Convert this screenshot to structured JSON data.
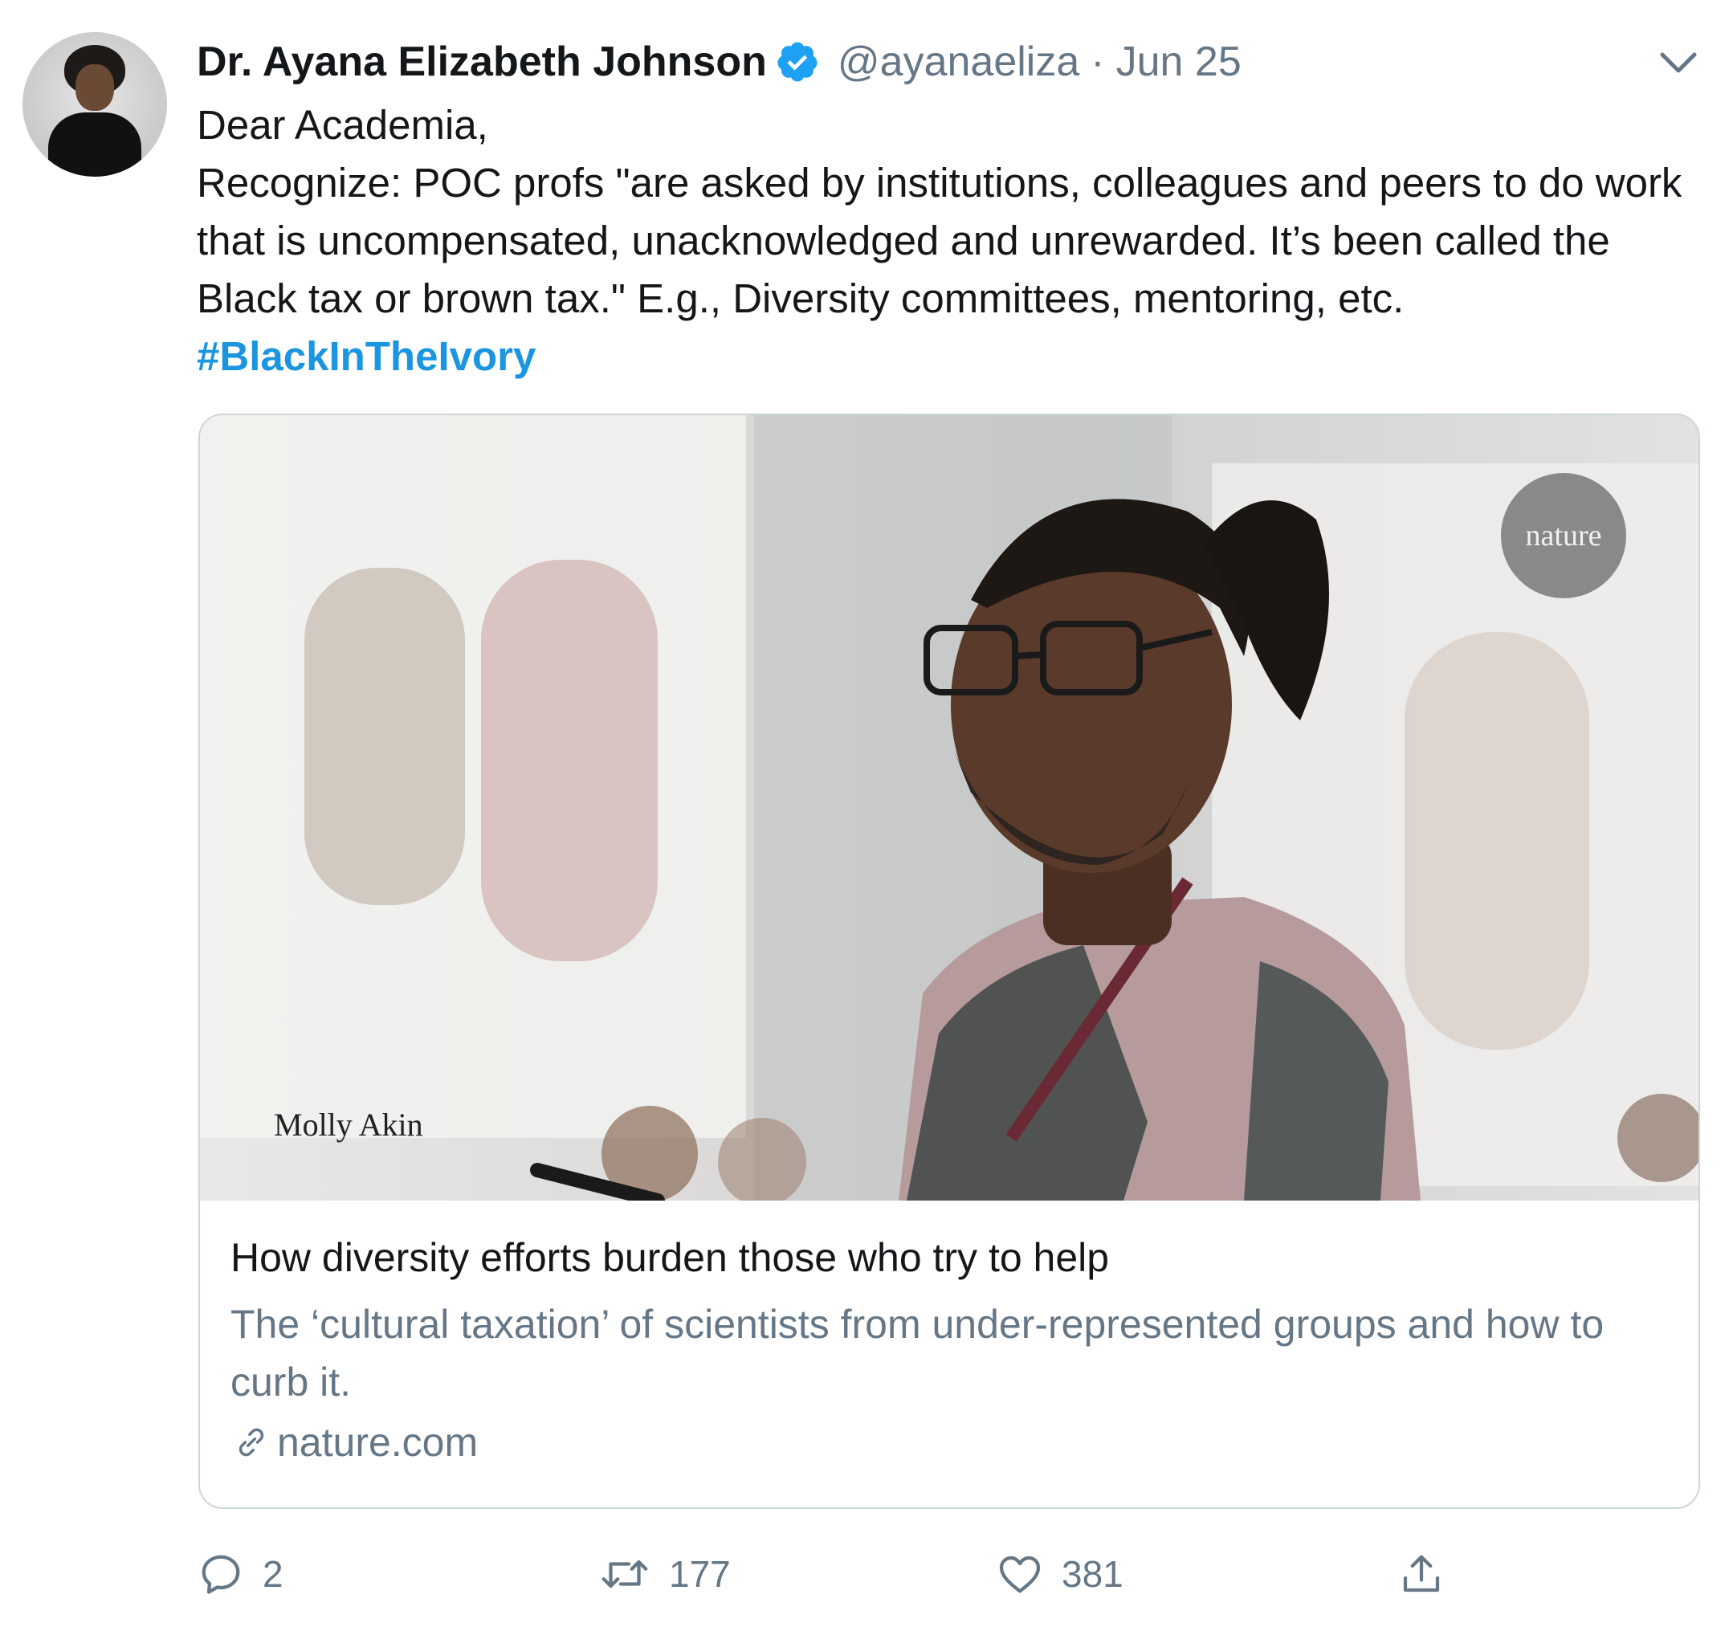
{
  "tweet": {
    "author_name": "Dr. Ayana Elizabeth Johnson",
    "handle": "@ayanaeliza",
    "separator": "·",
    "date": "Jun 25",
    "text_line1": "Dear Academia,",
    "text_line2": "Recognize: POC profs \"are asked by institutions, colleagues and peers to do work that is uncompensated, unacknowledged and unrewarded. It’s been called the Black tax or brown tax.\" E.g., Diversity committees, mentoring, etc. ",
    "hashtag": "#BlackInTheIvory"
  },
  "card": {
    "photo_credit": "Molly Akin",
    "badge": "nature",
    "title": "How diversity efforts burden those who try to help",
    "description": "The ‘cultural taxation’ of scientists from under-represented groups and how to curb it.",
    "domain": "nature.com"
  },
  "actions": {
    "replies": "2",
    "retweets": "177",
    "likes": "381"
  },
  "colors": {
    "accent": "#1b95e0",
    "secondary_text": "#657786",
    "border": "#ccd6dd"
  },
  "icons": [
    "verified-badge-icon",
    "chevron-down-icon",
    "link-icon",
    "reply-icon",
    "retweet-icon",
    "like-icon",
    "share-icon"
  ]
}
